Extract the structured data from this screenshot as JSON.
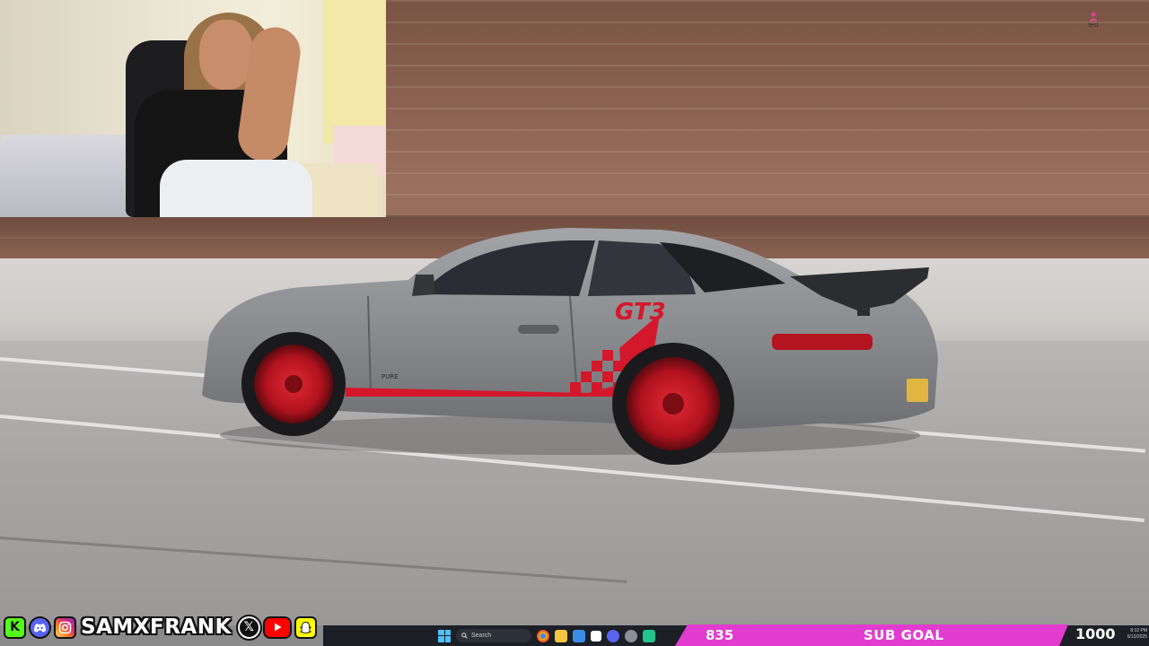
{
  "notification": {
    "label": "test",
    "icon": "person-icon"
  },
  "car": {
    "decal_text": "GT3",
    "brand_text": "PURE"
  },
  "socials": [
    {
      "name": "kick-icon",
      "glyph": "K"
    },
    {
      "name": "discord-icon",
      "glyph": ""
    },
    {
      "name": "instagram-icon",
      "glyph": ""
    },
    {
      "name": "x-icon",
      "glyph": "𝕏"
    },
    {
      "name": "youtube-icon",
      "glyph": ""
    },
    {
      "name": "snapchat-icon",
      "glyph": ""
    }
  ],
  "handle": "SAMXFRANK",
  "taskbar": {
    "search_placeholder": "Search"
  },
  "sub_goal": {
    "current": "835",
    "label": "SUB GOAL",
    "target": "1000"
  },
  "clock": {
    "time": "8:10 PM",
    "date": "6/10/2025"
  },
  "colors": {
    "sub_goal_bar": "#e23bd0",
    "taskbar": "#1c1f26",
    "car_body": "#8a8c8f",
    "car_accent": "#d5172b"
  }
}
